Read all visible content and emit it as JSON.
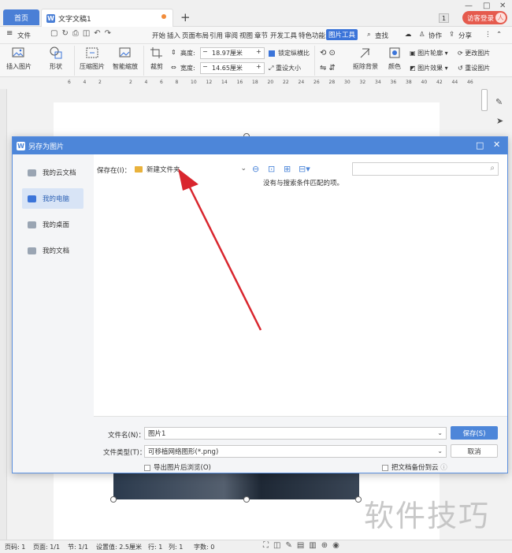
{
  "tabs": {
    "home": "首页",
    "doc_title": "文字文稿1",
    "new_tab": "+"
  },
  "topright": {
    "badge": "1",
    "login": "访客登录",
    "avatar": "人"
  },
  "window_controls": [
    "—",
    "□",
    "✕"
  ],
  "menu": {
    "file": "文件",
    "items": [
      "开始",
      "插入",
      "页面布局",
      "引用",
      "审阅",
      "视图",
      "章节",
      "开发工具",
      "特色功能",
      "图片工具"
    ],
    "active": "图片工具",
    "search": "查找",
    "collab": "协作",
    "share": "分享"
  },
  "ribbon": {
    "insert_image": "插入图片",
    "shape": "形状",
    "compress": "压缩图片",
    "smart_zoom": "智能缩放",
    "crop": "裁剪",
    "height_label": "高度:",
    "height_value": "18.97厘米",
    "width_label": "宽度:",
    "width_value": "14.65厘米",
    "lock_ratio": "锁定纵横比",
    "reset_size": "重设大小",
    "remove_bg": "抠除背景",
    "color": "颜色",
    "outline": "图片轮廓",
    "effect": "图片效果",
    "change_image": "更改图片",
    "reset_image": "重设图片"
  },
  "ruler": {
    "ticks": [
      "6",
      "4",
      "2",
      "",
      "2",
      "4",
      "6",
      "8",
      "10",
      "12",
      "14",
      "16",
      "18",
      "20",
      "22",
      "24",
      "26",
      "28",
      "30",
      "32",
      "34",
      "36",
      "38",
      "40",
      "42",
      "44",
      "46"
    ]
  },
  "dialog": {
    "title": "另存为图片",
    "sidebar": [
      "我的云文档",
      "我的电脑",
      "我的桌面",
      "我的文档"
    ],
    "active_sidebar": "我的电脑",
    "save_in_label": "保存在(I)：",
    "save_in_value": "新建文件夹",
    "search_placeholder": "",
    "no_result": "没有与搜索条件匹配的项。",
    "filename_label": "文件名(N)：",
    "filename_value": "图片1",
    "filetype_label": "文件类型(T)：",
    "filetype_value": "可移植网络图形(*.png)",
    "save_button": "保存(S)",
    "cancel_button": "取消",
    "open_after_export": "导出图片后浏览(O)",
    "backup_to_cloud": "把文档备份到云"
  },
  "status": {
    "page_num": "页码: 1",
    "pages": "页面: 1/1",
    "section": "节: 1/1",
    "setting": "设置值: 2.5厘米",
    "row": "行: 1",
    "col": "列: 1",
    "words": "字数: 0"
  },
  "watermark": "软件技巧",
  "colors": {
    "accent": "#4d86d9",
    "arrow": "#d9262e",
    "login": "#e55a4d"
  }
}
